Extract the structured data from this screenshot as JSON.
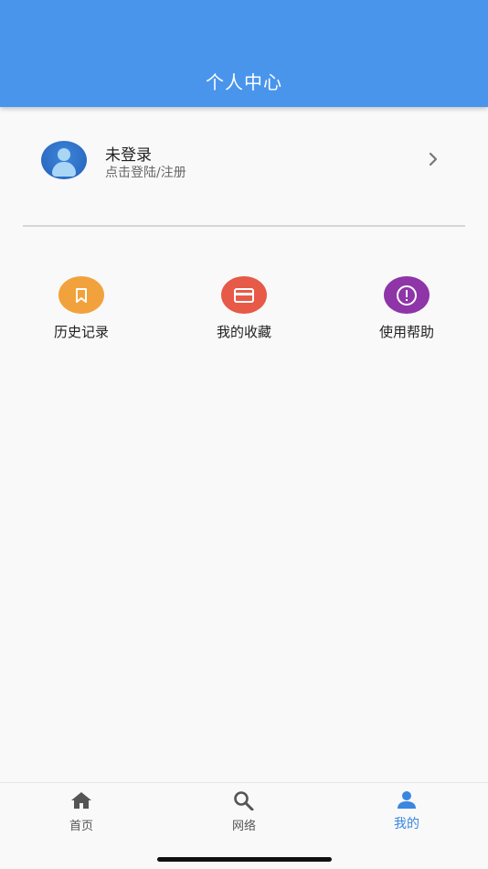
{
  "header": {
    "title": "个人中心"
  },
  "user": {
    "name": "未登录",
    "subtitle": "点击登陆/注册",
    "avatar_icon": "user-avatar-icon",
    "chevron_icon": "chevron-right-icon"
  },
  "shortcuts": [
    {
      "label": "历史记录",
      "icon": "bookmark-icon",
      "color": "#f2a23c"
    },
    {
      "label": "我的收藏",
      "icon": "card-icon",
      "color": "#e65a47"
    },
    {
      "label": "使用帮助",
      "icon": "alert-circle-icon",
      "color": "#8e35a8"
    }
  ],
  "bottom_nav": {
    "items": [
      {
        "label": "首页",
        "icon": "home-icon",
        "active": false
      },
      {
        "label": "网络",
        "icon": "search-icon",
        "active": false
      },
      {
        "label": "我的",
        "icon": "person-icon",
        "active": true
      }
    ],
    "active_color": "#3a86e0",
    "inactive_color": "#555555"
  },
  "colors": {
    "header": "#4a95ec",
    "background": "#f9f9f9"
  }
}
